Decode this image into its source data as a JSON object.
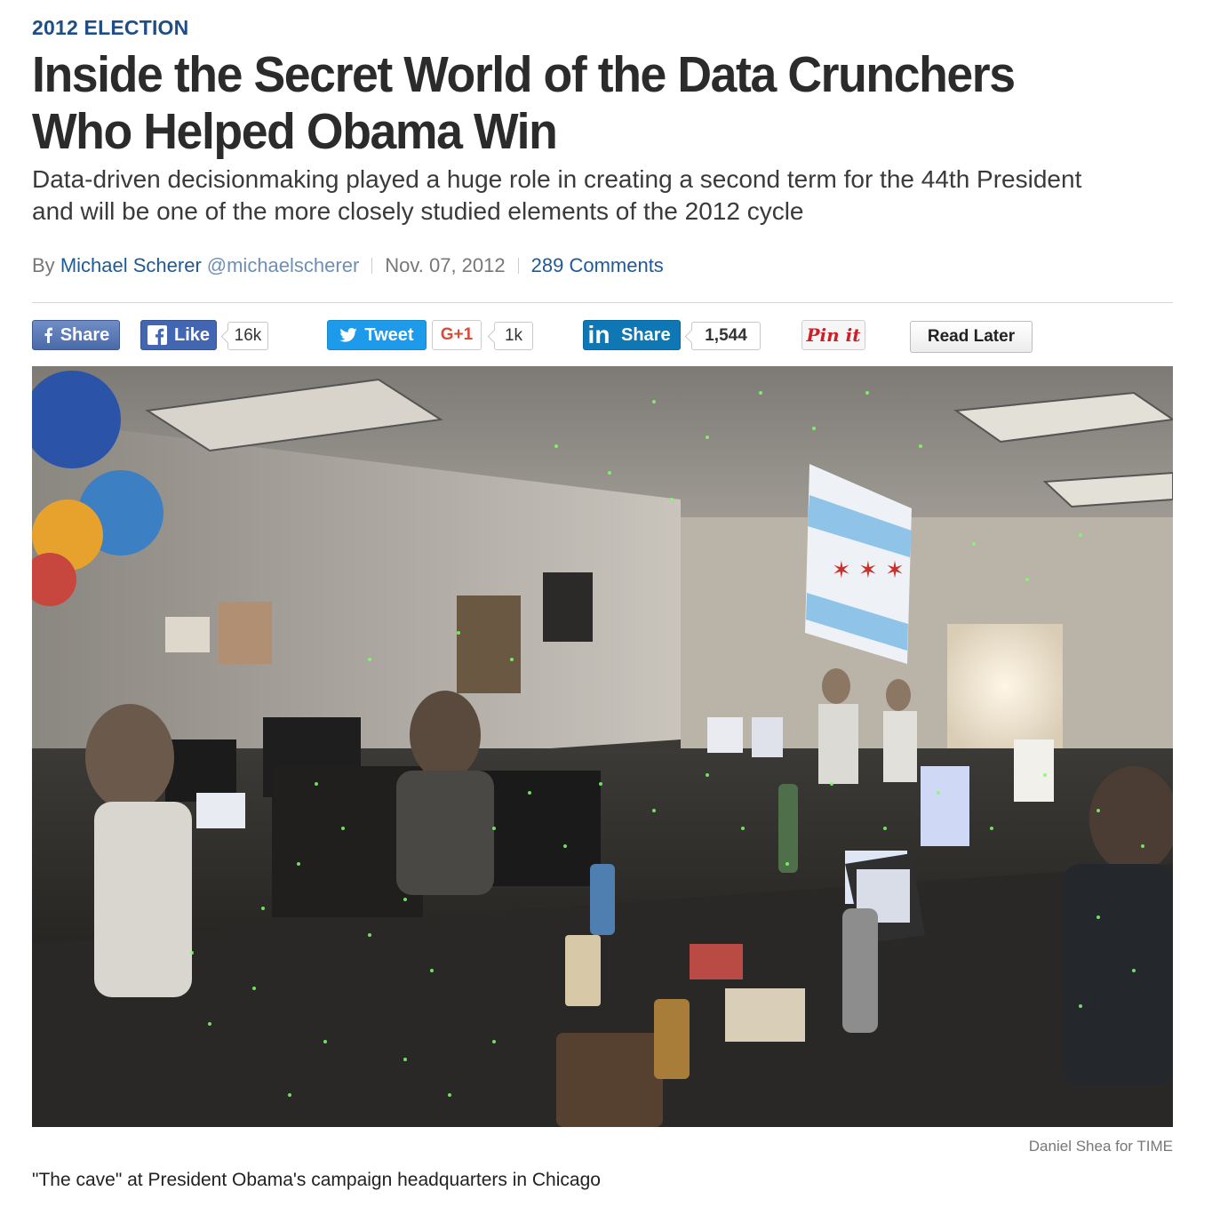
{
  "article": {
    "kicker": "2012 ELECTION",
    "headline": "Inside the Secret World of the Data Crunchers Who Helped Obama Win",
    "dek": "Data-driven decisionmaking played a huge role in creating a second term for the 44th President and will be one of the more closely studied elements of the 2012 cycle",
    "byline": {
      "prefix": "By",
      "author": "Michael Scherer",
      "handle": "@michaelscherer",
      "date": "Nov. 07, 2012",
      "comments": "289 Comments"
    }
  },
  "share_bar": {
    "facebook_share": "Share",
    "facebook_like": "Like",
    "facebook_like_count": "16k",
    "tweet": "Tweet",
    "gplus": "G+1",
    "gplus_count": "1k",
    "linkedin_logo": "in",
    "linkedin_share": "Share",
    "linkedin_count": "1,544",
    "pinterest": "Pin it",
    "read_later": "Read Later"
  },
  "photo": {
    "credit": "Daniel Shea for TIME",
    "caption": "\"The cave\" at President Obama's campaign headquarters in Chicago"
  },
  "colors": {
    "kicker": "#1f4e86",
    "link": "#1f5a96",
    "facebook": "#4266b2",
    "twitter": "#1d9bea",
    "linkedin": "#0e77b4",
    "pinterest": "#cb2027",
    "gplus": "#dd4b39"
  }
}
